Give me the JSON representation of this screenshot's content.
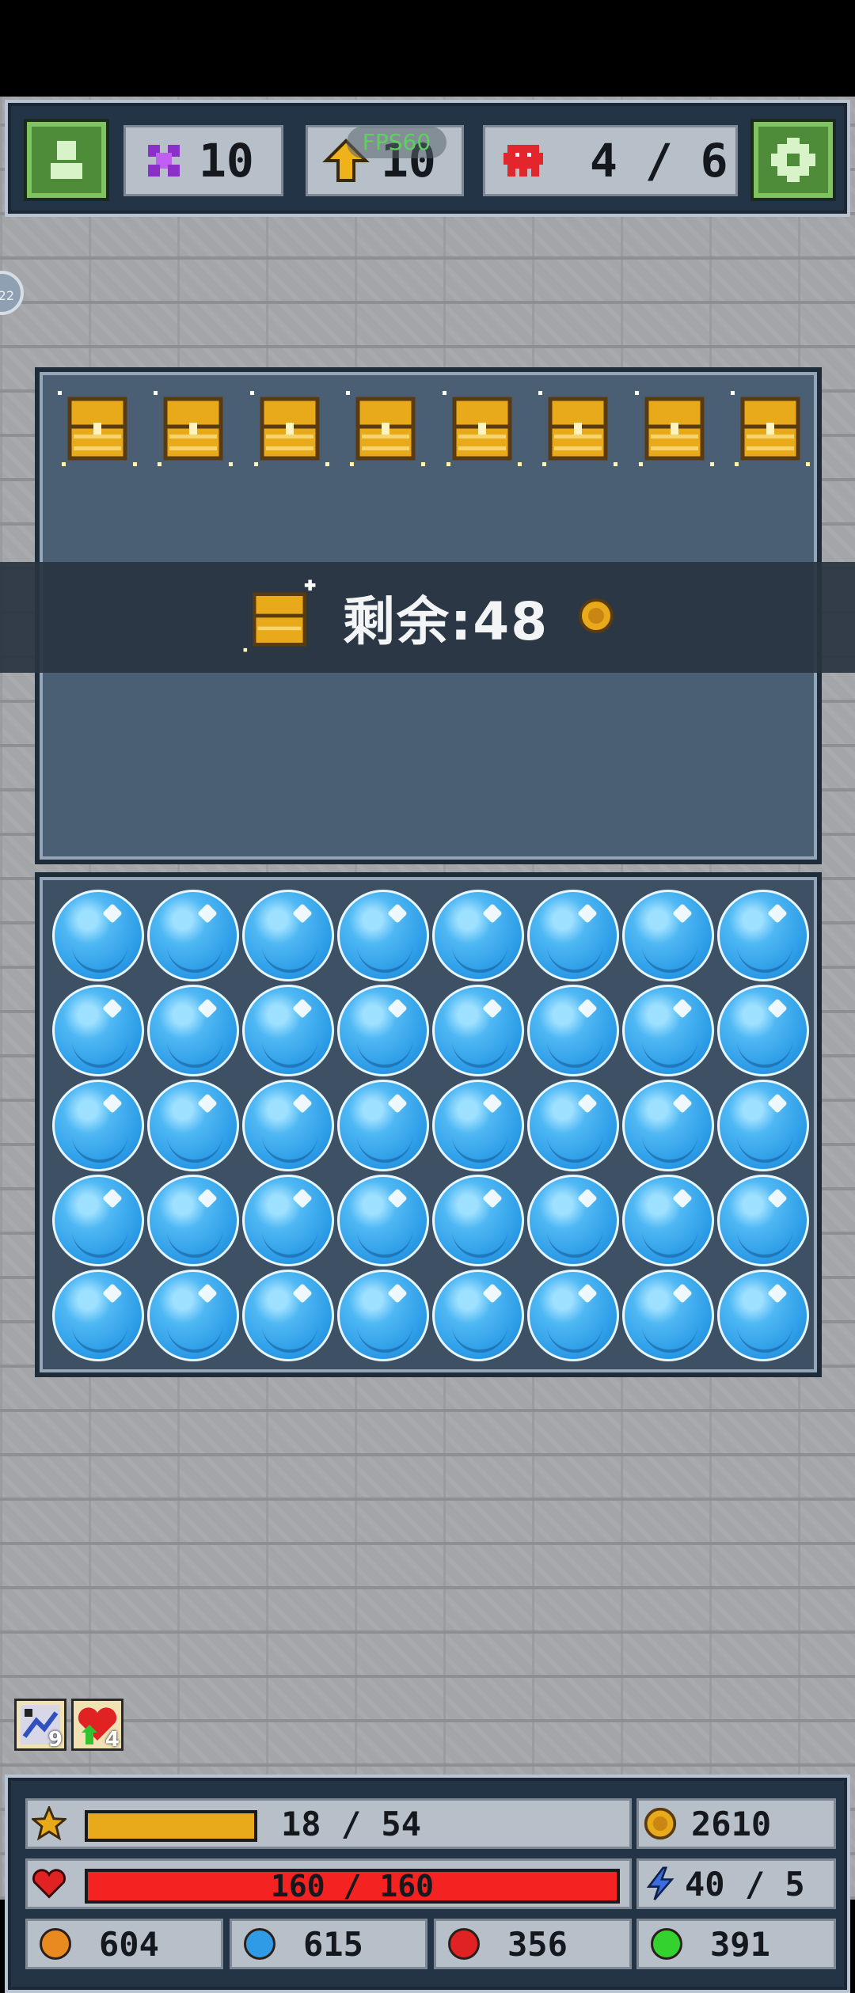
{
  "top_hud": {
    "profile_icon": "person-icon",
    "gems": "10",
    "upgrades": "10",
    "fps": "FPS60",
    "monsters": "4 / 6",
    "settings_icon": "gear-icon"
  },
  "side_badge": "22",
  "chests": {
    "count": 8,
    "banner_label": "剩余:48"
  },
  "bubbles": {
    "rows": 5,
    "cols": 8
  },
  "buffs": [
    {
      "icon": "map-icon",
      "count": "9"
    },
    {
      "icon": "heart-up-icon",
      "count": "4"
    }
  ],
  "stats": {
    "xp": "18 / 54",
    "xp_fraction": 0.333,
    "gold": "2610",
    "hp": "160 / 160",
    "hp_fraction": 1.0,
    "attack": "40 / 5",
    "orange_orbs": "604",
    "blue_orbs": "615",
    "red_orbs": "356",
    "green_orbs": "391"
  },
  "colors": {
    "orange": "#e88a1f",
    "blue": "#2f9be6",
    "red": "#e02222",
    "green": "#33d22f"
  }
}
